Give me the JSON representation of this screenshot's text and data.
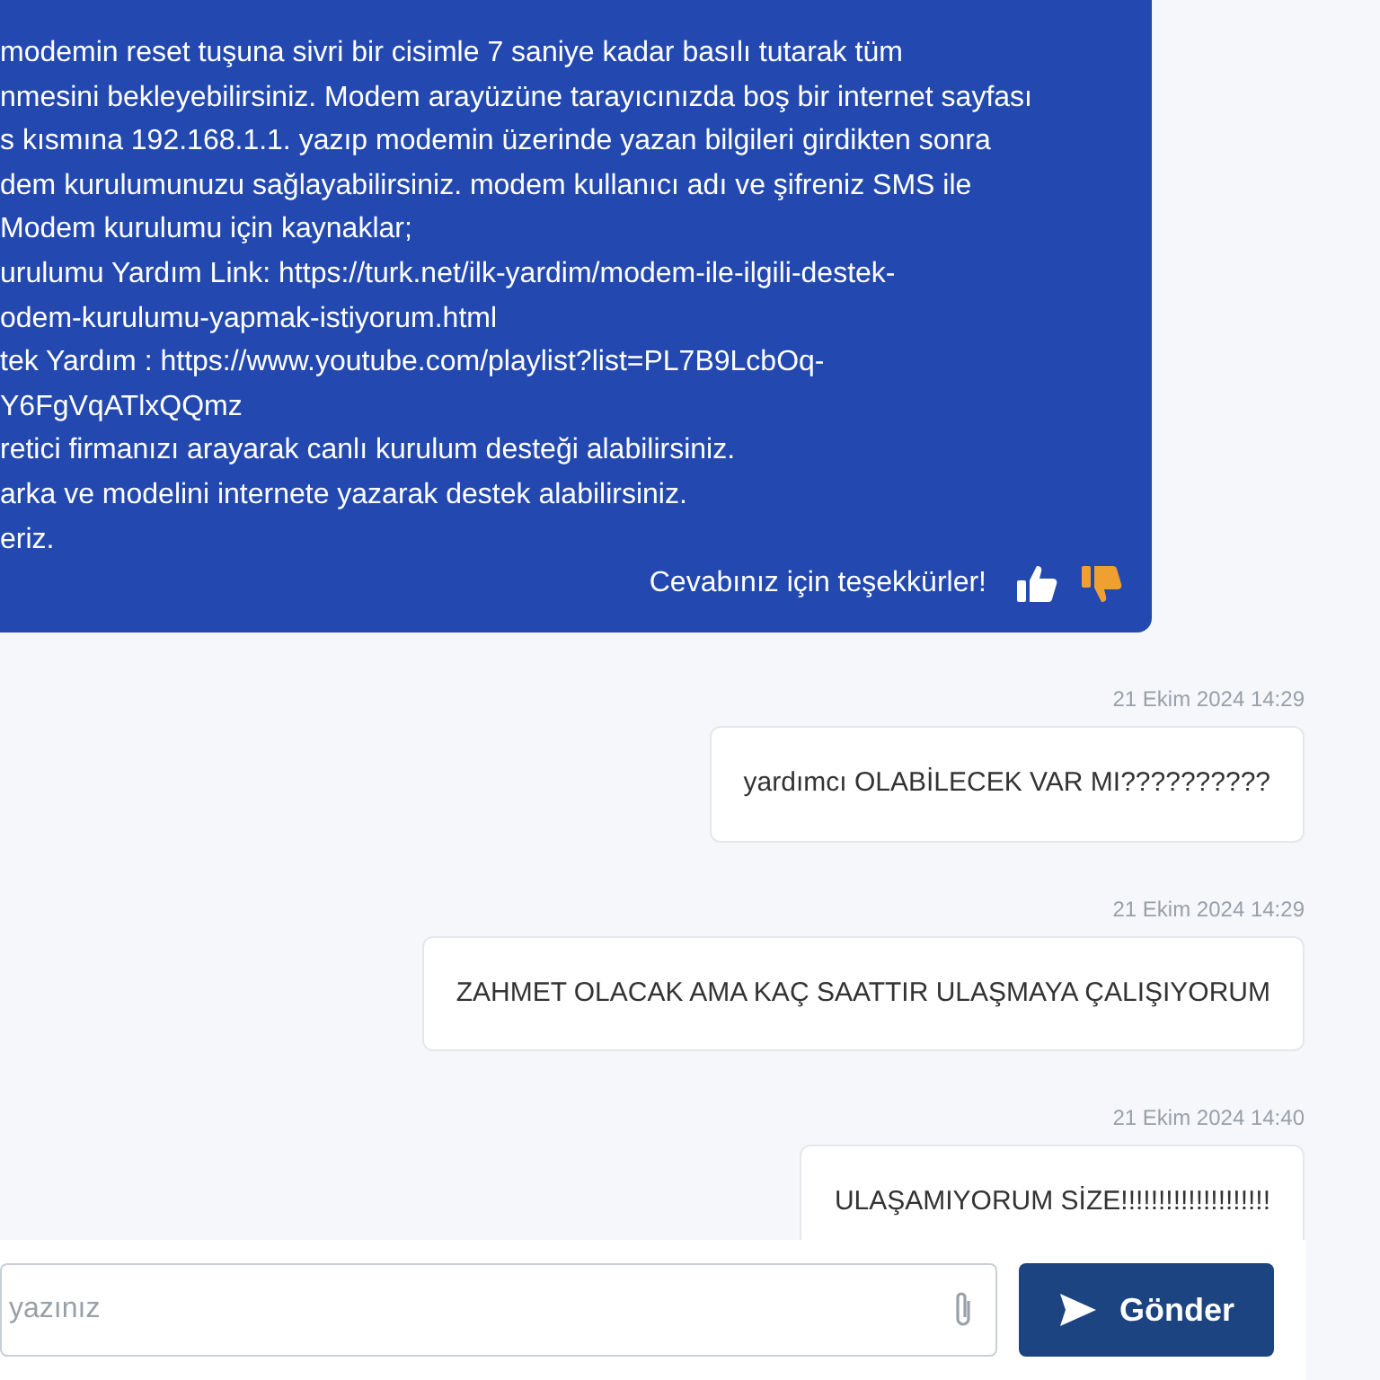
{
  "bot_message": {
    "lines": [
      "modemin reset tuşuna sivri bir cisimle 7 saniye kadar basılı tutarak tüm",
      "nmesini bekleyebilirsiniz. Modem arayüzüne tarayıcınızda boş bir internet sayfası",
      "s kısmına 192.168.1.1. yazıp modemin üzerinde yazan bilgileri girdikten sonra",
      "dem kurulumunuzu sağlayabilirsiniz. modem kullanıcı adı ve şifreniz SMS ile",
      "Modem kurulumu için kaynaklar;",
      "urulumu Yardım Link: https://turk.net/ilk-yardim/modem-ile-ilgili-destek-",
      "odem-kurulumu-yapmak-istiyorum.html",
      "tek Yardım : https://www.youtube.com/playlist?list=PL7B9LcbOq-",
      "Y6FgVqATlxQQmz",
      "retici firmanızı arayarak canlı kurulum desteği alabilirsiniz.",
      "arka ve modelini internete yazarak destek alabilirsiniz.",
      "eriz."
    ],
    "feedback_text": "Cevabınız için teşekkürler!",
    "feedback": [
      {
        "kind": "up",
        "selected": false
      },
      {
        "kind": "down",
        "selected": true
      }
    ]
  },
  "user_messages": [
    {
      "time": "21 Ekim 2024 14:29",
      "text": "yardımcı OLABİLECEK VAR MI??????????"
    },
    {
      "time": "21 Ekim 2024 14:29",
      "text": "ZAHMET OLACAK AMA KAÇ SAATTIR ULAŞMAYA ÇALIŞIYORUM"
    },
    {
      "time": "21 Ekim 2024 14:40",
      "text": "ULAŞAMIYORUM SİZE!!!!!!!!!!!!!!!!!!!!"
    }
  ],
  "composer": {
    "placeholder": "yazınız",
    "send_label": "Gönder"
  }
}
